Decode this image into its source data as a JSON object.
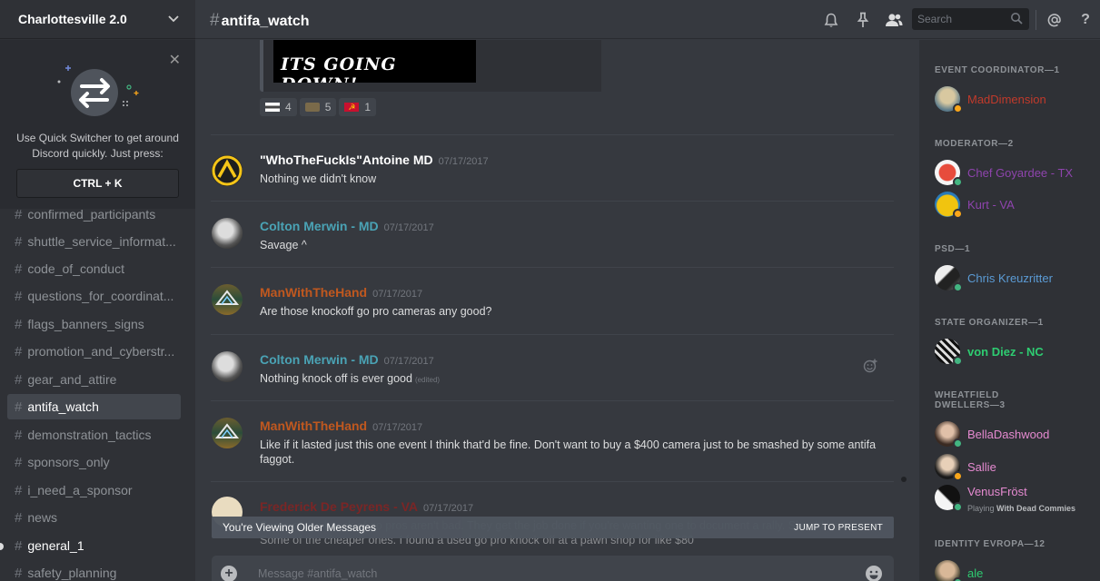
{
  "guild": {
    "name": "Charlottesville 2.0"
  },
  "quick_switcher": {
    "text": "Use Quick Switcher to get around Discord quickly. Just press:",
    "shortcut": "CTRL + K"
  },
  "channels": [
    {
      "name": "confirmed_participants"
    },
    {
      "name": "shuttle_service_informat..."
    },
    {
      "name": "code_of_conduct"
    },
    {
      "name": "questions_for_coordinat..."
    },
    {
      "name": "flags_banners_signs"
    },
    {
      "name": "promotion_and_cyberstr..."
    },
    {
      "name": "gear_and_attire"
    },
    {
      "name": "antifa_watch"
    },
    {
      "name": "demonstration_tactics"
    },
    {
      "name": "sponsors_only"
    },
    {
      "name": "i_need_a_sponsor"
    },
    {
      "name": "news"
    },
    {
      "name": "general_1"
    },
    {
      "name": "safety_planning"
    }
  ],
  "header": {
    "hash": "#",
    "channel": "antifa_watch",
    "search_placeholder": "Search"
  },
  "embed": {
    "image_text": "ITS GOING DOWN!"
  },
  "reactions": [
    {
      "count": "4"
    },
    {
      "count": "5"
    },
    {
      "count": "1"
    }
  ],
  "messages": [
    {
      "author": "\"WhoTheFuckIs\"Antoine MD",
      "time": "07/17/2017",
      "text": "Nothing we didn't know",
      "color": "#ffffff"
    },
    {
      "author": "Colton Merwin - MD",
      "time": "07/17/2017",
      "text": "Savage ^",
      "color": "#4aa3b5"
    },
    {
      "author": "ManWithTheHand",
      "time": "07/17/2017",
      "text": "Are those knockoff go pro cameras any good?",
      "color": "#c0581f"
    },
    {
      "author": "Colton Merwin - MD",
      "time": "07/17/2017",
      "text": "Nothing knock off is ever good",
      "edited": "(edited)",
      "color": "#4aa3b5"
    },
    {
      "author": "ManWithTheHand",
      "time": "07/17/2017",
      "text": "Like if it lasted just this one event I think that'd be fine. Don't want to buy a $400 camera just to be smashed by some antifa faggot.",
      "color": "#c0581f"
    },
    {
      "author": "Frederick De Peyrens - VA",
      "time": "07/17/2017",
      "text": "Some of the knock of go pros aren't bad. They get the job done if you're wanting one to document a rally. Should be fine. Some of the cheaper ones. I found a used go pro knock off at a pawn shop for like $80",
      "color": "#7a2626"
    }
  ],
  "older_bar": {
    "text": "You're Viewing Older Messages",
    "jump": "JUMP TO PRESENT"
  },
  "composer": {
    "placeholder": "Message #antifa_watch"
  },
  "member_groups": [
    {
      "title": "EVENT COORDINATOR—1"
    },
    {
      "title": "MODERATOR—2"
    },
    {
      "title": "PSD—1"
    },
    {
      "title": "STATE ORGANIZER—1"
    },
    {
      "title": "WHEATFIELD DWELLERS—3"
    },
    {
      "title": "IDENTITY EVROPA—12"
    }
  ],
  "members": [
    {
      "name": "MadDimension",
      "color": "#c03a2b",
      "status": "#faa61a"
    },
    {
      "name": "Chef Goyardee - TX",
      "color": "#8e44ad",
      "status": "#43b581"
    },
    {
      "name": "Kurt - VA",
      "color": "#8e44ad",
      "status": "#faa61a"
    },
    {
      "name": "Chris Kreuzritter",
      "color": "#5b9bd5",
      "status": "#43b581"
    },
    {
      "name": "von Diez - NC",
      "color": "#2ecc71",
      "status": "#43b581"
    },
    {
      "name": "BellaDashwood",
      "color": "#e58ad0",
      "status": "#43b581"
    },
    {
      "name": "Sallie",
      "color": "#e58ad0",
      "status": "#faa61a"
    },
    {
      "name": "VenusFröst",
      "color": "#e58ad0",
      "status": "#43b581",
      "playing_prefix": "Playing",
      "game": "With Dead Commies"
    },
    {
      "name": "ale",
      "color": "#2ecc71",
      "status": "#43b581"
    }
  ]
}
